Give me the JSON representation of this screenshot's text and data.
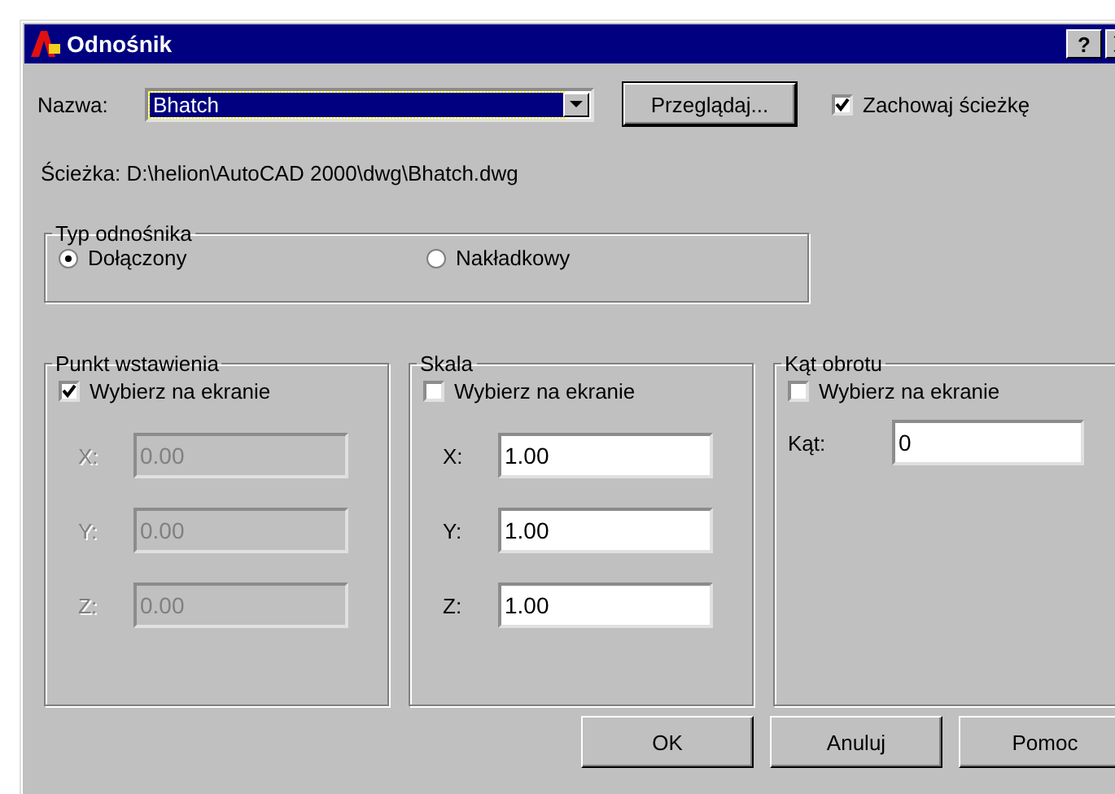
{
  "window": {
    "title": "Odnośnik",
    "help_button": "?"
  },
  "name_field": {
    "label": "Nazwa:",
    "value": "Bhatch",
    "selected": true
  },
  "browse_button": "Przeglądaj...",
  "keep_path": {
    "label": "Zachowaj ścieżkę",
    "checked": true
  },
  "path_text": "Ścieżka: D:\\helion\\AutoCAD 2000\\dwg\\Bhatch.dwg",
  "reference_type": {
    "title": "Typ odnośnika",
    "options": [
      {
        "label": "Dołączony",
        "selected": true
      },
      {
        "label": "Nakładkowy",
        "selected": false
      }
    ]
  },
  "groups": [
    {
      "title": "Punkt wstawienia",
      "pick": {
        "label": "Wybierz na ekranie",
        "checked": true
      },
      "fields": [
        {
          "label": "X:",
          "value": "0.00",
          "disabled": true
        },
        {
          "label": "Y:",
          "value": "0.00",
          "disabled": true
        },
        {
          "label": "Z:",
          "value": "0.00",
          "disabled": true
        }
      ]
    },
    {
      "title": "Skala",
      "pick": {
        "label": "Wybierz na ekranie",
        "checked": false
      },
      "fields": [
        {
          "label": "X:",
          "value": "1.00",
          "disabled": false
        },
        {
          "label": "Y:",
          "value": "1.00",
          "disabled": false
        },
        {
          "label": "Z:",
          "value": "1.00",
          "disabled": false
        }
      ]
    },
    {
      "title": "Kąt obrotu",
      "pick": {
        "label": "Wybierz na ekranie",
        "checked": false
      },
      "fields": [
        {
          "label": "Kąt:",
          "value": "0",
          "disabled": false
        }
      ]
    }
  ],
  "buttons": [
    "OK",
    "Anuluj",
    "Pomoc"
  ]
}
